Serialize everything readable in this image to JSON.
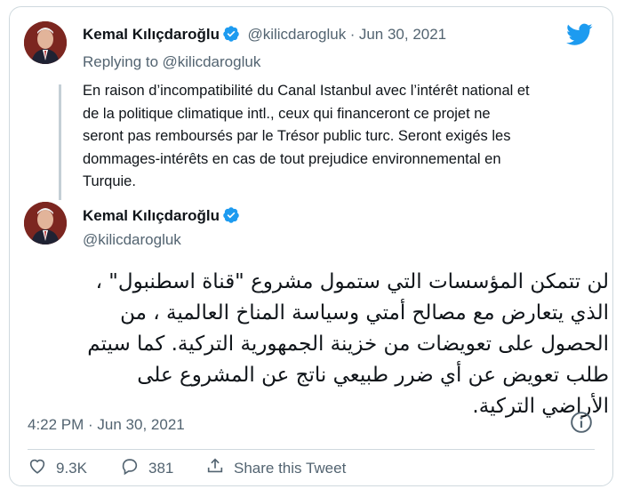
{
  "tweet1": {
    "name": "Kemal Kılıçdaroğlu",
    "handle": "@kilicdarogluk",
    "separator": "·",
    "date": "Jun 30, 2021",
    "replying_prefix": "Replying to",
    "replying_handle": "@kilicdarogluk",
    "text_lines": [
      "En raison d’incompatibilité du Canal Istanbul avec l’intérêt national et",
      "de la politique climatique intl., ceux qui financeront ce projet ne",
      "seront pas remboursés par le Trésor public turc. Seront exigés les",
      "dommages-intérêts en cas de tout prejudice environnemental en",
      "Turquie."
    ]
  },
  "tweet2": {
    "name": "Kemal Kılıçdaroğlu",
    "handle": "@kilicdarogluk",
    "text_lines": [
      "لن تتمكن المؤسسات التي ستمول مشروع \"قناة اسطنبول\" ،",
      "الذي يتعارض مع مصالح أمتي وسياسة المناخ العالمية ، من",
      "الحصول على تعويضات من خزينة الجمهورية التركية.  كما سيتم",
      "طلب تعويض عن أي ضرر طبيعي ناتج عن المشروع على",
      "الأراضي التركية."
    ],
    "timestamp": "4:22 PM · Jun 30, 2021"
  },
  "actions": {
    "likes": "9.3K",
    "replies": "381",
    "share_label": "Share this Tweet"
  },
  "icons": {
    "brand": "twitter-bird-icon",
    "verified": "verified-badge-icon",
    "info": "info-icon",
    "like": "heart-icon",
    "reply": "reply-bubble-icon",
    "share": "share-icon"
  },
  "colors": {
    "twitter_blue": "#1d9bf0",
    "muted_text": "#536471",
    "border": "#cfd9de"
  }
}
